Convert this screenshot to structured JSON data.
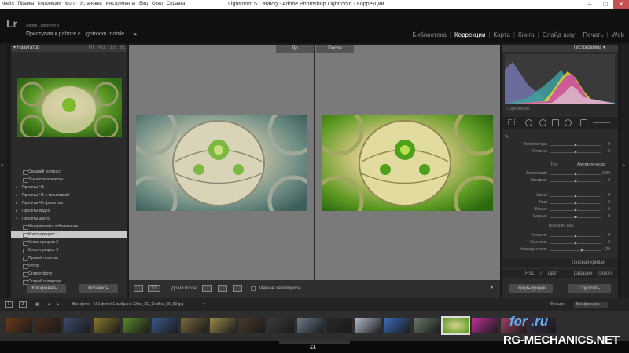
{
  "window": {
    "title": "Lightroom 5 Catalog - Adobe Photoshop Lightroom - Коррекции",
    "menu": [
      "Файл",
      "Правка",
      "Коррекции",
      "Фото",
      "Установки",
      "Инструменты",
      "Вид",
      "Окно",
      "Справка"
    ],
    "controls": [
      "–",
      "□",
      "✕"
    ]
  },
  "identity": {
    "logo": "Lr",
    "product": "Adobe Lightroom 5",
    "mobile_link": "Приступая к работе с Lightroom mobile",
    "modules": [
      "Библиотека",
      "Коррекции",
      "Карта",
      "Книга",
      "Слайд-шоу",
      "Печать",
      "Web"
    ],
    "active_module": "Коррекции"
  },
  "left_panel": {
    "navigator_title": "Навигатор",
    "zoom_options": [
      "FIT",
      "FILL",
      "1:1",
      "3:1"
    ],
    "presets": [
      {
        "label": "Средний контраст",
        "kind": "item"
      },
      {
        "label": "Тон автоматически",
        "kind": "item"
      },
      {
        "label": "Пресеты ЧБ",
        "kind": "group"
      },
      {
        "label": "Пресеты ЧБ с тонировкой",
        "kind": "group"
      },
      {
        "label": "Пресеты ЧБ фильтров",
        "kind": "group"
      },
      {
        "label": "Пресеты видео",
        "kind": "group"
      },
      {
        "label": "Пресеты цвета",
        "kind": "group-open"
      },
      {
        "label": "Игнорировать отбеливание",
        "kind": "item"
      },
      {
        "label": "Кросс-процесс 1",
        "kind": "item-selected"
      },
      {
        "label": "Кросс-процесс 2",
        "kind": "item"
      },
      {
        "label": "Кросс-процесс 3",
        "kind": "item"
      },
      {
        "label": "Прямой позитив",
        "kind": "item"
      },
      {
        "label": "Ретро",
        "kind": "item"
      },
      {
        "label": "Старое фото",
        "kind": "item"
      },
      {
        "label": "Старый полароид",
        "kind": "item"
      }
    ],
    "copy_button": "Копировать...",
    "paste_button": "Вставить"
  },
  "viewer": {
    "before_label": "До",
    "after_label": "После",
    "before_after_label": "До и После :",
    "soft_proof_label": "Мягкая цветопроба"
  },
  "right_panel": {
    "histogram_title": "Гистограмма",
    "original_label": "Оригиналы",
    "sliders": [
      {
        "label": "Температура",
        "value": "0",
        "pos": 0.5
      },
      {
        "label": "Оттенок",
        "value": "0",
        "pos": 0.5
      },
      {
        "label": "Экспозиция",
        "value": "0,00",
        "pos": 0.5
      },
      {
        "label": "Контраст",
        "value": "0",
        "pos": 0.5
      },
      {
        "label": "Света",
        "value": "0",
        "pos": 0.5
      },
      {
        "label": "Тени",
        "value": "0",
        "pos": 0.5
      },
      {
        "label": "Белые",
        "value": "0",
        "pos": 0.5
      },
      {
        "label": "Черные",
        "value": "0",
        "pos": 0.5
      },
      {
        "label": "Четкость",
        "value": "0",
        "pos": 0.5
      },
      {
        "label": "Сочность",
        "value": "0",
        "pos": 0.5
      },
      {
        "label": "Насыщенность",
        "value": "+ 20",
        "pos": 0.62
      }
    ],
    "tone_label": "Тон",
    "auto_label": "Автоматически",
    "presence_label": "Внешний вид",
    "tone_curve": "Тоновая кривая",
    "hsl_tabs": [
      "HSL",
      "Цвет",
      "Градации серого"
    ],
    "previous_button": "Предыдущие",
    "reset_button": "Сбросить"
  },
  "filmstrip_bar": {
    "source": "Все фото",
    "count": "161 фото/ 1 выбрано /",
    "filename": "Oboi_3D_Grafika_55_59.jpg",
    "filter_label": "Фильтр:",
    "filter_value": "Без фильтра"
  },
  "footer": {
    "sa": "SA"
  },
  "watermark": {
    "top": "for .ru",
    "bottom": "RG-MECHANICS.NET"
  },
  "colors": {
    "accent": "#ffffff",
    "panel": "#2b2b2b",
    "viewer_bg": "#7a7a7a",
    "watermark_blue": "#5bb0e6"
  }
}
